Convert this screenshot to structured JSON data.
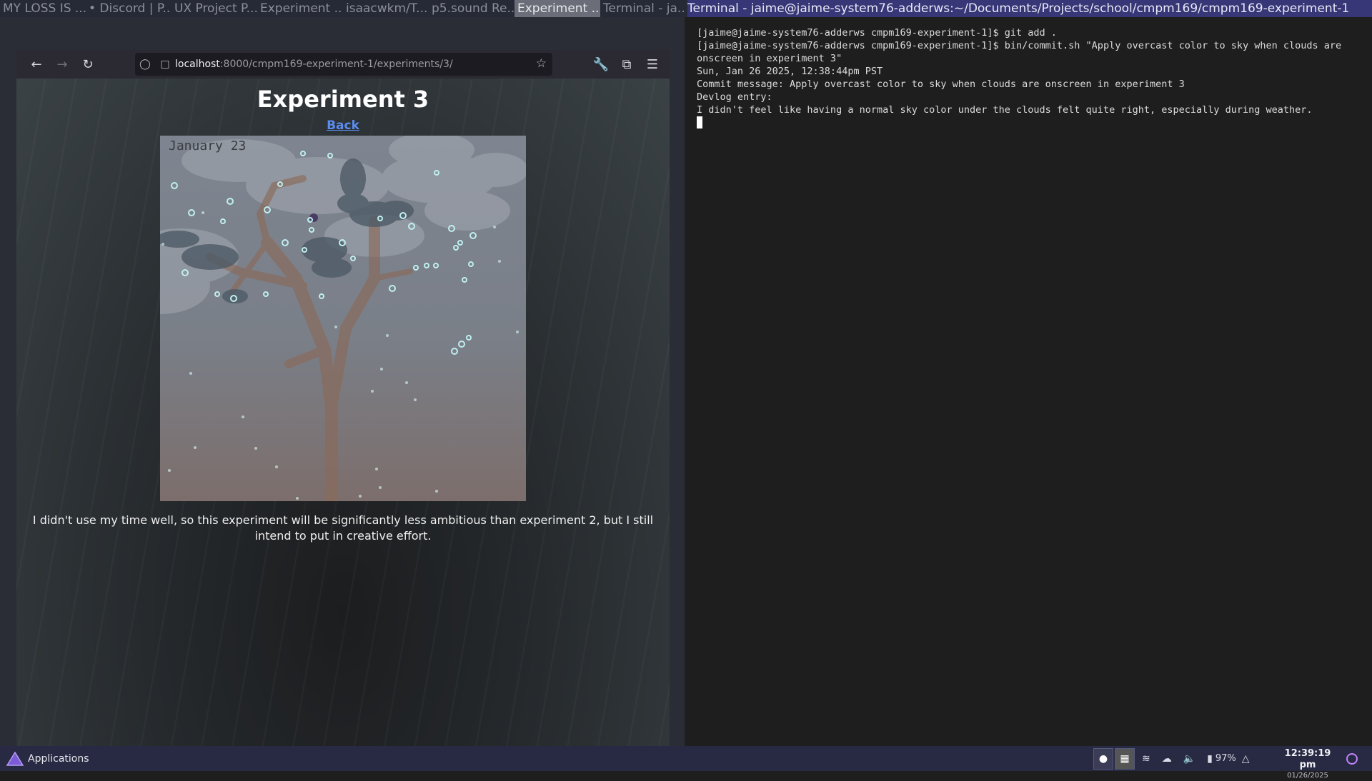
{
  "window_tabs": [
    {
      "label": "MY LOSS IS ...",
      "active": false
    },
    {
      "label": "• Discord | P...",
      "active": false
    },
    {
      "label": "UX Project P...",
      "active": false
    },
    {
      "label": "Experiment ...",
      "active": false
    },
    {
      "label": "isaacwkm/T...",
      "active": false
    },
    {
      "label": "p5.sound Re...",
      "active": false
    },
    {
      "label": "Experiment ...",
      "active": true
    },
    {
      "label": "Terminal - ja...",
      "active": false
    }
  ],
  "terminal_title": "Terminal - jaime@jaime-system76-adderws:~/Documents/Projects/school/cmpm169/cmpm169-experiment-1",
  "browser": {
    "url_host": "localhost",
    "url_rest": ":8000/cmpm169-experiment-1/experiments/3/",
    "page": {
      "title": "Experiment 3",
      "back_label": "Back",
      "canvas_date": "January 23",
      "description": "I didn't use my time well, so this experiment will be significantly less ambitious than experiment 2, but I still intend to put in creative effort."
    }
  },
  "terminal": {
    "lines": [
      "[jaime@jaime-system76-adderws cmpm169-experiment-1]$ git add .",
      "[jaime@jaime-system76-adderws cmpm169-experiment-1]$ bin/commit.sh \"Apply overcast color to sky when clouds are onscreen in experiment 3\"",
      "Sun, Jan 26 2025, 12:38:44pm PST",
      "Commit message: Apply overcast color to sky when clouds are onscreen in experiment 3",
      "Devlog entry:",
      "I didn't feel like having a normal sky color under the clouds felt quite right, especially during weather."
    ]
  },
  "panel": {
    "apps_label": "Applications",
    "battery": "97%",
    "time": "12:39:19 pm",
    "date": "01/26/2025"
  },
  "colors": {
    "panel_bg": "#282a44",
    "term_title_bg": "#373777",
    "link": "#5b8cf0"
  }
}
